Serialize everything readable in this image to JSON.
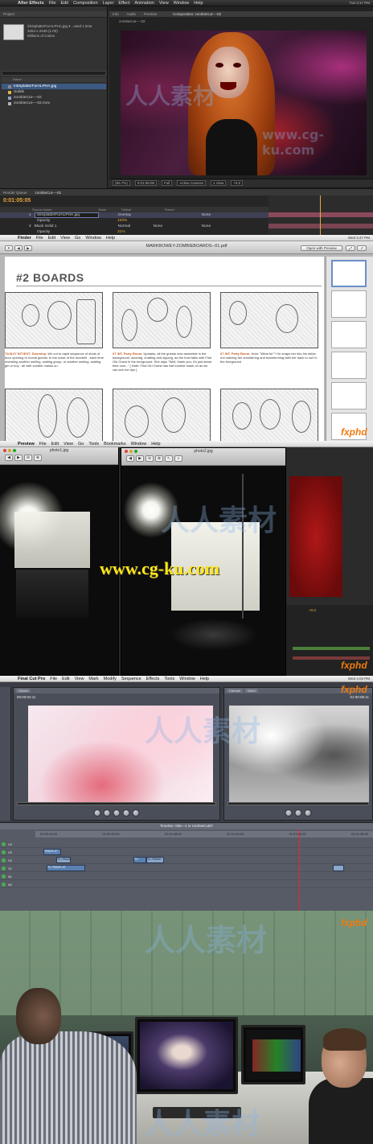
{
  "brand": {
    "fxphd": "fxphd",
    "watermark": "人人素材",
    "watermark_domain": "www.cg-ku.com"
  },
  "after_effects": {
    "menubar": {
      "app": "After Effects",
      "items": [
        "File",
        "Edit",
        "Composition",
        "Layer",
        "Effect",
        "Animation",
        "View",
        "Window",
        "Help"
      ],
      "right": [
        "Tue 3:17 PM"
      ]
    },
    "window_title": "gradeGuidePack.aep *",
    "project_panel": {
      "tab": "Project",
      "file_name": "inkSplatterForALPHA.jpg ▾ , used 1 time",
      "file_dims": "3264 x 2448 (1.00)",
      "file_color": "Millions of Colors",
      "col_header": "Name",
      "items": [
        {
          "name": "inkSplatterForALPHA.jpg",
          "selected": true
        },
        {
          "name": "Solids",
          "selected": false
        },
        {
          "name": "zombieCut----02",
          "selected": false
        },
        {
          "name": "zombieCut----02.mov",
          "selected": false
        }
      ]
    },
    "comp_tabs": [
      "Info",
      "Audio",
      "Preview"
    ],
    "comp_title": "Composition: zombieCut----02",
    "comp_subtab": "zombieCut----02",
    "viewer_controls": [
      "(50.7%)",
      "0:01:05:05",
      "Full",
      "Active Camera",
      "1 View",
      "+0.0"
    ],
    "timeline": {
      "tabs": [
        "Render Queue",
        "zombieCut----02"
      ],
      "timecode": "0:01:05:05",
      "headers": [
        "Source Name",
        "Mode",
        "TrkMat",
        "Parent"
      ],
      "layers": [
        {
          "num": "1",
          "name": "inkSplatterForALPHA.jpg",
          "mode": "Overlay",
          "trk": "",
          "parent": "None",
          "selected": true
        },
        {
          "num": "",
          "name": "Opacity",
          "mode": "100%",
          "trk": "",
          "parent": "",
          "selected": false
        },
        {
          "num": "2",
          "name": "Black Solid 1",
          "mode": "Normal",
          "trk": "None",
          "parent": "None",
          "selected": false
        },
        {
          "num": "",
          "name": "Opacity",
          "mode": "31%",
          "trk": "",
          "parent": "",
          "selected": false
        }
      ]
    }
  },
  "storyboard": {
    "menubar": {
      "app": "Finder",
      "items": [
        "File",
        "Edit",
        "View",
        "Go",
        "Window",
        "Help"
      ],
      "right": [
        "Wed 3:47 PM"
      ]
    },
    "doc_title": "MARKBOWEY-ZOMBIEBOARDS--01.pdf",
    "open_with": "Open with Preview",
    "heading": "#2 BOARDS",
    "captions": [
      {
        "id": "7A.B.07",
        "scene": "INT./EXT. Doorstep.",
        "text": "We cut to rapid sequence of shots of door opening to reveal guests: to the noise of the doorbell - each time revealing another smiling, waiting group, or another smiling, waiting girl or boy - all with zombie masks on."
      },
      {
        "id": "07",
        "scene": "INT. Party Room.",
        "text": "Upstairs, all the guests now assemble in the background, dancing, chatting and sipping, as the host talks with First Girl Guest in the foreground. She says \"Well, thank you, it's just about time now...\" [ Note: First Girl Guest has half zombie mask on as we can see her lips ]"
      },
      {
        "id": "07",
        "scene": "INT. Party Room.",
        "text": "Host: \"What for\"? He snaps her into his stride, not noticing her smoldering and transforming faith her back to us2 in the foreground"
      }
    ]
  },
  "preview": {
    "menubar": {
      "app": "Preview",
      "items": [
        "File",
        "Edit",
        "View",
        "Go",
        "Tools",
        "Bookmarks",
        "Window",
        "Help"
      ],
      "right": [
        "Search Help"
      ]
    },
    "win1_title": "photo1.jpg",
    "win2_title": "photo2.jpg",
    "toolbar": [
      "◀",
      "▶",
      "⊖",
      "⊕",
      "↖",
      "⌕"
    ],
    "timeline_values": [
      "+0.0"
    ]
  },
  "fcp": {
    "menubar": {
      "app": "Final Cut Pro",
      "items": [
        "File",
        "Edit",
        "View",
        "Mark",
        "Modify",
        "Sequence",
        "Effects",
        "Tools",
        "Window",
        "Help"
      ],
      "right": [
        "Wed 4:03 PM"
      ]
    },
    "viewer_tabs": [
      "Viewer",
      "Canvas"
    ],
    "viewer_tc": "00:00:04:11",
    "canvas_tc": "01:00:08:11",
    "canvas_tabs": [
      "Video"
    ],
    "timeline_title": "Timeline: 006---1 in zombieCut07",
    "ruler": [
      "01:00:16:00",
      "01:00:32:00",
      "01:00:48:00",
      "01:01:04:00",
      "01:01:20:00",
      "01:01:36:00"
    ],
    "tracks": [
      {
        "name": "V4",
        "clips": []
      },
      {
        "name": "V3",
        "clips": [
          {
            "label": "TRACK-07",
            "style": "b",
            "start": 10,
            "len": 22
          }
        ]
      },
      {
        "name": "V2",
        "clips": [
          {
            "label": "TC-TRACK",
            "style": "a",
            "start": 26,
            "len": 18
          },
          {
            "label": "TC-",
            "style": "b",
            "start": 122,
            "len": 16
          },
          {
            "label": "TC-TRACK",
            "style": "a",
            "start": 138,
            "len": 22
          }
        ]
      },
      {
        "name": "V1",
        "clips": [
          {
            "label": "TC-TRACK-07",
            "style": "b",
            "start": 14,
            "len": 48
          },
          {
            "label": "",
            "style": "a",
            "start": 370,
            "len": 14
          }
        ]
      },
      {
        "name": "A1",
        "clips": []
      },
      {
        "name": "A2",
        "clips": []
      }
    ]
  }
}
